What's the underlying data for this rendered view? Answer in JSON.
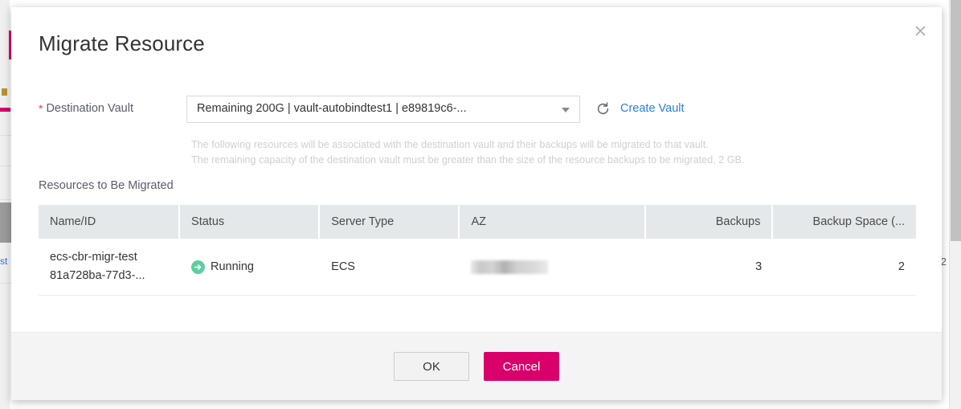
{
  "dialog": {
    "title": "Migrate Resource",
    "close_icon": "close-icon",
    "form": {
      "destination_vault": {
        "label": "Destination Vault",
        "required_marker": "*",
        "selected_value": "Remaining 200G | vault-autobindtest1 | e89819c6-...",
        "refresh_icon": "refresh-icon",
        "create_vault_link": "Create Vault"
      },
      "hints": [
        "The following resources will be associated with the destination vault and their backups will be migrated to that vault.",
        "The remaining capacity of the destination vault must be greater than the size of the resource backups to be migrated, 2 GB."
      ]
    },
    "section_label": "Resources to Be Migrated",
    "table": {
      "columns": [
        {
          "label": "Name/ID",
          "align": "left"
        },
        {
          "label": "Status",
          "align": "left"
        },
        {
          "label": "Server Type",
          "align": "left"
        },
        {
          "label": "AZ",
          "align": "left"
        },
        {
          "label": "Backups",
          "align": "right"
        },
        {
          "label": "Backup Space (...",
          "align": "right"
        }
      ],
      "rows": [
        {
          "name_line1": "ecs-cbr-migr-test",
          "name_line2": "81a728ba-77d3-...",
          "status": "Running",
          "status_icon": "running-arrow-icon",
          "server_type": "ECS",
          "az": "",
          "az_redacted": true,
          "backups": "3",
          "backup_space": "2"
        }
      ]
    },
    "footer": {
      "ok_label": "OK",
      "cancel_label": "Cancel"
    }
  },
  "colors": {
    "primary": "#d9006c",
    "link": "#2b7fd4",
    "required": "#e8413b",
    "status_running": "#5ccea0",
    "table_header_bg": "#e4e8ea",
    "footer_bg": "#f4f4f4"
  }
}
